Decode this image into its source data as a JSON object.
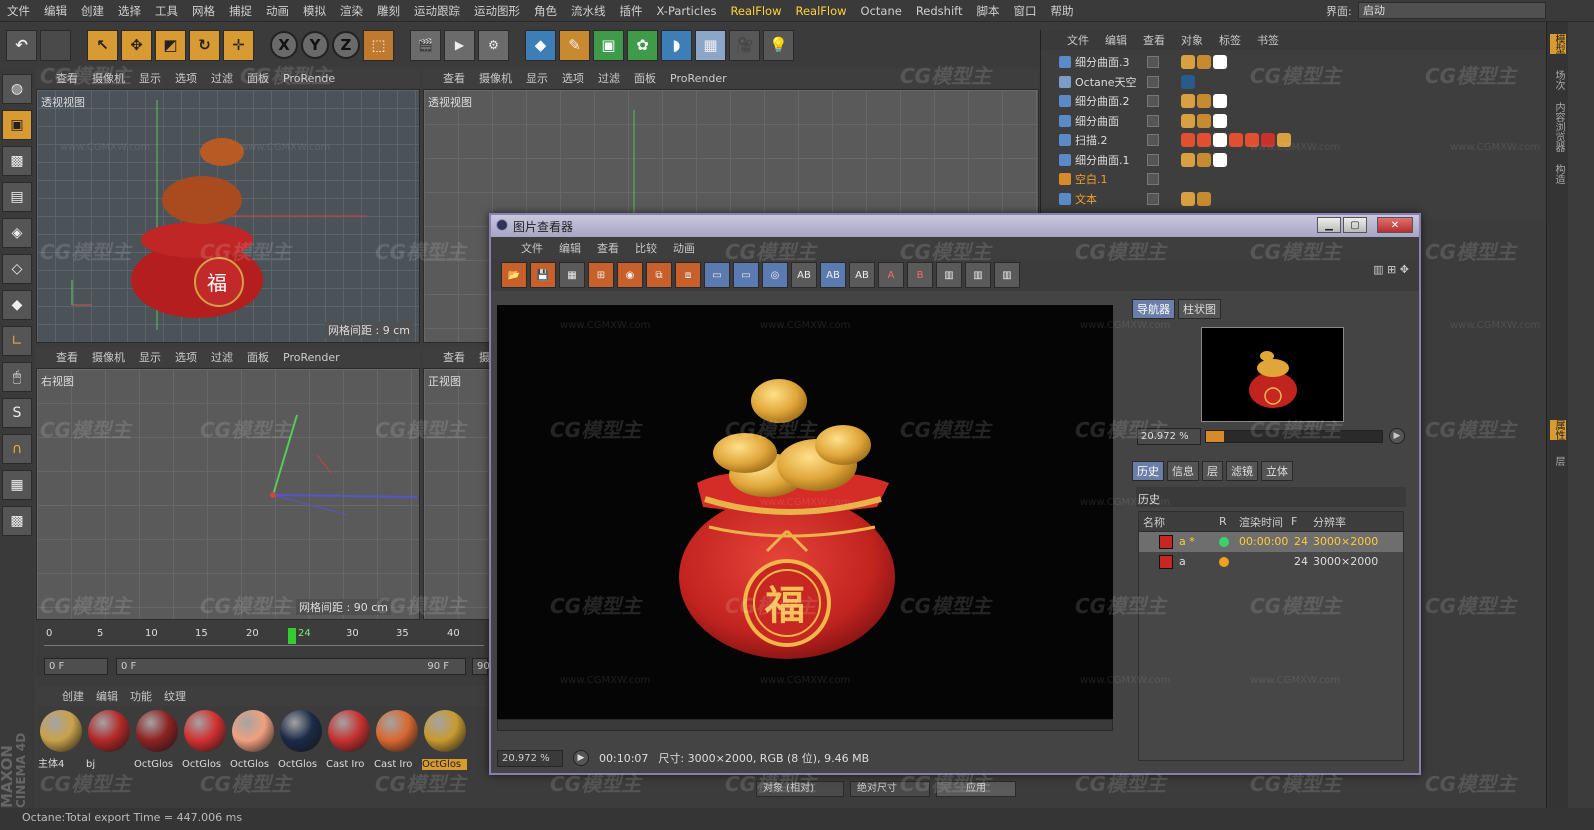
{
  "menubar": {
    "items": [
      "文件",
      "编辑",
      "创建",
      "选择",
      "工具",
      "网格",
      "捕捉",
      "动画",
      "模拟",
      "渲染",
      "雕刻",
      "运动跟踪",
      "运动图形",
      "角色",
      "流水线",
      "插件",
      "X-Particles",
      "RealFlow",
      "RealFlow",
      "Octane",
      "Redshift",
      "脚本",
      "窗口",
      "帮助"
    ],
    "layout_label": "界面:",
    "layout_value": "启动"
  },
  "viewports": {
    "top_left": {
      "menu": [
        "查看",
        "摄像机",
        "显示",
        "选项",
        "过滤",
        "面板",
        "ProRende"
      ],
      "title": "透视视图",
      "grid_info": "网格间距 : 9 cm"
    },
    "top_right": {
      "menu": [
        "查看",
        "摄像机",
        "显示",
        "选项",
        "过滤",
        "面板",
        "ProRender"
      ],
      "title": "透视视图"
    },
    "bottom_left": {
      "menu": [
        "查看",
        "摄像机",
        "显示",
        "选项",
        "过滤",
        "面板",
        "ProRender"
      ],
      "title": "右视图",
      "grid_info": "网格间距 : 90 cm"
    },
    "bottom_right": {
      "menu": [
        "查看",
        "摄像机"
      ],
      "title": "正视图"
    }
  },
  "timeline": {
    "ticks": [
      "0",
      "5",
      "10",
      "15",
      "20",
      "24",
      "30",
      "35",
      "40"
    ],
    "current_frame": 24,
    "start_field": "0 F",
    "range_start": "0 F",
    "range_end": "90 F",
    "end_field": "90"
  },
  "materials": {
    "menu": [
      "创建",
      "编辑",
      "功能",
      "纹理"
    ],
    "items": [
      {
        "label": "主体4",
        "color": "#c9a24a"
      },
      {
        "label": "bj",
        "color": "#b32828"
      },
      {
        "label": "OctGlos",
        "color": "#8e2222"
      },
      {
        "label": "OctGlos",
        "color": "#d23030"
      },
      {
        "label": "OctGlos",
        "color": "#f0a080"
      },
      {
        "label": "OctGlos",
        "color": "#1c2a48"
      },
      {
        "label": "Cast Iro",
        "color": "#c83030"
      },
      {
        "label": "Cast Iro",
        "color": "#d86830"
      },
      {
        "label": "OctGlos",
        "color": "#c89a30"
      }
    ]
  },
  "object_manager": {
    "menu": [
      "文件",
      "编辑",
      "查看",
      "对象",
      "标签",
      "书签"
    ],
    "objects": [
      {
        "name": "细分曲面.3"
      },
      {
        "name": "Octane天空"
      },
      {
        "name": "细分曲面.2"
      },
      {
        "name": "细分曲面"
      },
      {
        "name": "扫描.2"
      },
      {
        "name": "细分曲面.1"
      },
      {
        "name": "空白.1"
      },
      {
        "name": "文本"
      }
    ]
  },
  "right_strip": [
    "模型",
    "场次",
    "内容浏览器",
    "构造",
    "属性",
    "层"
  ],
  "picture_viewer": {
    "title": "图片查看器",
    "menu": [
      "文件",
      "编辑",
      "查看",
      "比较",
      "动画"
    ],
    "nav_tabs": [
      "导航器",
      "柱状图"
    ],
    "zoom": "20.972 %",
    "zoom_fraction": 0.1,
    "history_tabs": [
      "历史",
      "信息",
      "层",
      "滤镜",
      "立体"
    ],
    "history_title": "历史",
    "history_columns": [
      "名称",
      "R",
      "渲染时间",
      "F",
      "分辨率"
    ],
    "history_rows": [
      {
        "name": "a *",
        "status_color": "#3cd26a",
        "time": "00:00:00",
        "frame": "24",
        "res": "3000×2000"
      },
      {
        "name": "a",
        "status_color": "#f0a020",
        "time": "",
        "frame": "24",
        "res": "3000×2000"
      }
    ],
    "status_zoom": "20.972 %",
    "status_time": "00:10:07",
    "status_info": "尺寸: 3000×2000, RGB (8 位), 9.46 MB"
  },
  "bottom_controls": {
    "mode": "对象 (相对)",
    "size": "绝对尺寸",
    "apply": "应用"
  },
  "statusbar": {
    "text": "Octane:Total export Time = 447.006 ms"
  },
  "logo": {
    "brand": "MAXON",
    "product": "CINEMA 4D"
  },
  "watermark": {
    "text": "CG模型主",
    "url": "www.CGMXW.com"
  }
}
